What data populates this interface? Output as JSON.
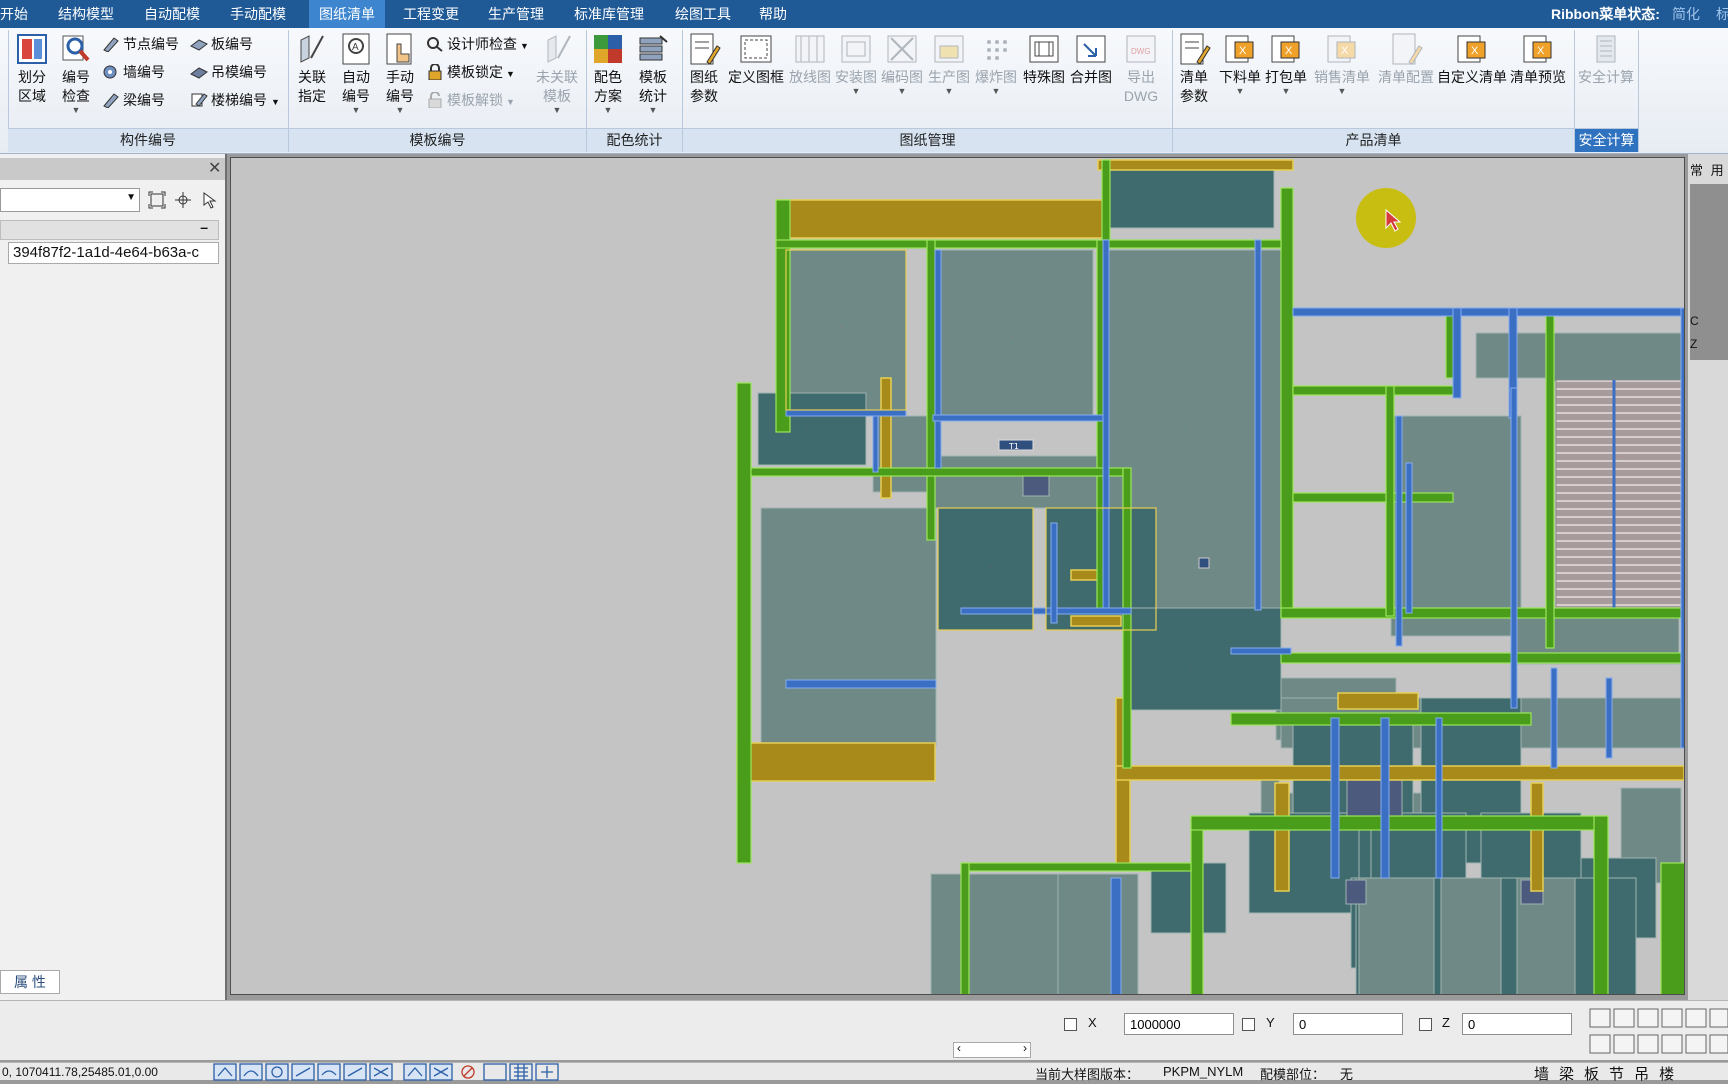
{
  "menu": {
    "items": [
      "开始",
      "结构模型",
      "自动配模",
      "手动配模",
      "图纸清单",
      "工程变更",
      "生产管理",
      "标准库管理",
      "绘图工具",
      "帮助"
    ],
    "active_index": 4,
    "ribbon_state_label": "Ribbon菜单状态:",
    "ribbon_state_value": "简化",
    "ribbon_state_extra": "标"
  },
  "ribbon": {
    "groups": {
      "component_numbering": "构件编号",
      "formwork_numbering": "模板编号",
      "color_stats": "配色统计",
      "drawing_mgmt": "图纸管理",
      "product_list": "产品清单",
      "safety_calc": "安全计算"
    },
    "divide_region": [
      "划分",
      "区域"
    ],
    "number_check": [
      "编号",
      "检查"
    ],
    "node_numbering": "节点编号",
    "wall_numbering": "墙编号",
    "beam_numbering": "梁编号",
    "slab_numbering": "板编号",
    "hanging_numbering": "吊模编号",
    "stair_numbering": "楼梯编号",
    "associate_assign": [
      "关联",
      "指定"
    ],
    "auto_numbering": [
      "自动",
      "编号"
    ],
    "manual_numbering": [
      "手动",
      "编号"
    ],
    "designer_check": "设计师检查",
    "formwork_lock": "模板锁定",
    "formwork_unlock": "模板解锁",
    "unassociated": [
      "未关联",
      "模板"
    ],
    "color_scheme": [
      "配色",
      "方案"
    ],
    "formwork_stats": [
      "模板",
      "统计"
    ],
    "drawing_params": [
      "图纸",
      "参数"
    ],
    "define_frame": "定义图框",
    "layout_drawing": "放线图",
    "install_drawing": "安装图",
    "code_drawing": "编码图",
    "production_drawing": "生产图",
    "exploded_drawing": "爆炸图",
    "special_drawing": "特殊图",
    "merge_drawing": "合并图",
    "export_dwg": [
      "导出",
      "DWG"
    ],
    "list_params": [
      "清单",
      "参数"
    ],
    "cutting_list": "下料单",
    "packing_list": "打包单",
    "sales_list": "销售清单",
    "list_config": "清单配置",
    "custom_list": "自定义清单",
    "list_preview": "清单预览",
    "safety_calc_btn": "安全计算"
  },
  "left_panel": {
    "id_value": "394f87f2-1a1d-4e64-b63a-c",
    "properties_tab": "属 性"
  },
  "right_panel": {
    "title": "常 用 命",
    "c_label": "C",
    "z_label": "Z"
  },
  "canvas": {
    "label_t1": "T1",
    "fill_colors": {
      "floor": "#6f8986",
      "dark_slab": "#3f6b6e",
      "beam": "#a78a1a",
      "wall_green": "#4a9d1a",
      "wall_blue": "#3a6fc4",
      "cursor_halo": "#c8be12"
    }
  },
  "coords": {
    "x_label": "X",
    "x_value": "1000000",
    "y_label": "Y",
    "y_value": "0",
    "z_label": "Z",
    "z_value": "0"
  },
  "status": {
    "coordinates": "0, 1070411.78,25485.01,0.00",
    "version_label": "当前大样图版本：",
    "version_value": "PKPM_NYLM",
    "position_label": "配模部位：",
    "position_value": "无",
    "quick_tabs": [
      "墙",
      "梁",
      "板",
      "节",
      "吊",
      "楼"
    ]
  }
}
